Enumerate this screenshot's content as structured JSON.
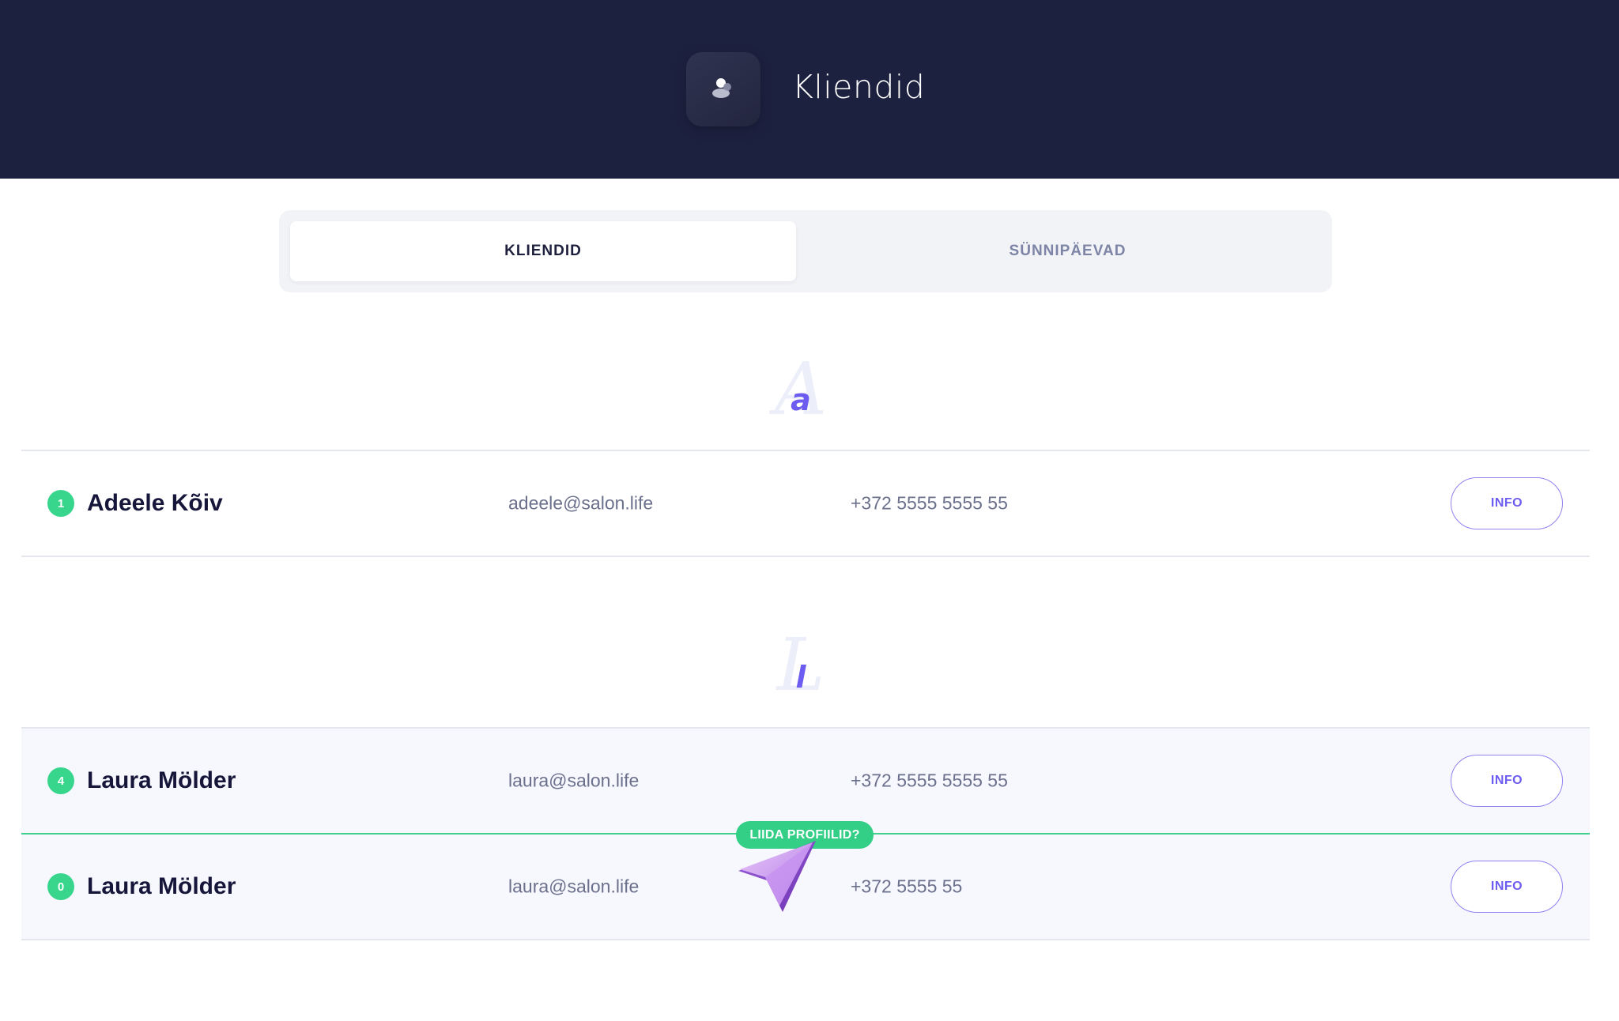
{
  "header": {
    "title": "Kliendid",
    "icon": "user-icon",
    "background": "#1d2140"
  },
  "tabs": [
    {
      "label": "KLIENDID",
      "active": true
    },
    {
      "label": "SÜNNIPÄEVAD",
      "active": false
    }
  ],
  "sections": [
    {
      "letter_big": "A",
      "letter_small": "a",
      "clients": [
        {
          "count": "1",
          "name": "Adeele Kõiv",
          "email": "adeele@salon.life",
          "phone": "+372 5555 5555 55",
          "button": "INFO"
        }
      ]
    },
    {
      "letter_big": "L",
      "letter_small": "l",
      "clients": [
        {
          "count": "4",
          "name": "Laura Mölder",
          "email": "laura@salon.life",
          "phone": "+372 5555 5555 55",
          "button": "INFO"
        },
        {
          "count": "0",
          "name": "Laura Mölder",
          "email": "laura@salon.life",
          "phone": "+372 5555 55",
          "button": "INFO"
        }
      ]
    }
  ],
  "merge_prompt": {
    "label": "LIIDA PROFIILID?"
  },
  "colors": {
    "accent": "#6d5cf0",
    "badge": "#37d68c",
    "merge": "#33cf86"
  }
}
